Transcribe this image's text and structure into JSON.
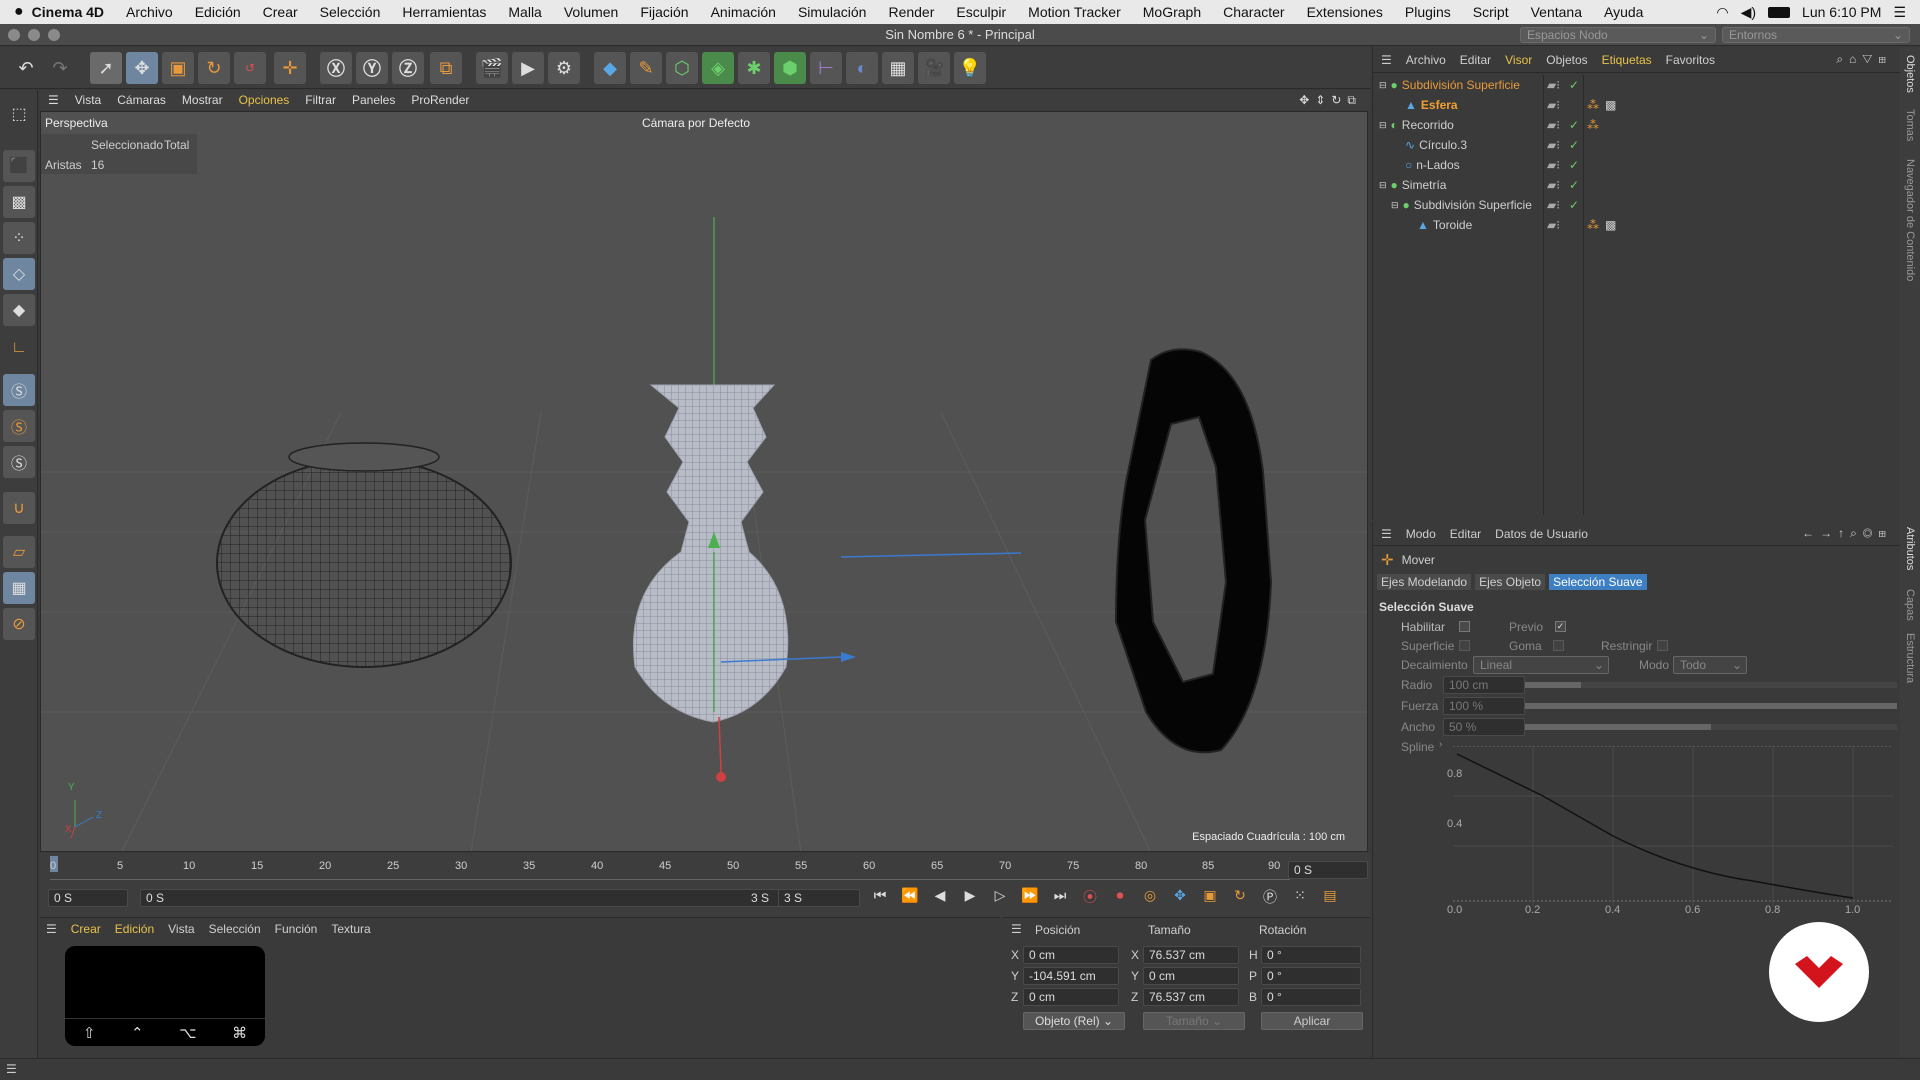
{
  "menubar": {
    "app": "Cinema 4D",
    "items": [
      "Archivo",
      "Edición",
      "Crear",
      "Selección",
      "Herramientas",
      "Malla",
      "Volumen",
      "Fijación",
      "Animación",
      "Simulación",
      "Render",
      "Esculpir",
      "Motion Tracker",
      "MoGraph",
      "Character",
      "Extensiones",
      "Plugins",
      "Script",
      "Ventana",
      "Ayuda"
    ],
    "clock": "Lun 6:10 PM"
  },
  "window": {
    "title": "Sin Nombre 6 * - Principal",
    "layout_combo": "Espacios Nodo",
    "env_combo": "Entornos"
  },
  "viewport": {
    "menu": [
      "Vista",
      "Cámaras",
      "Mostrar",
      "Opciones",
      "Filtrar",
      "Paneles",
      "ProRender"
    ],
    "active_menu": "Opciones",
    "label": "Perspectiva",
    "camera": "Cámara por Defecto",
    "stats": {
      "selected_header": "Seleccionado",
      "total_header": "Total",
      "row_label": "Aristas",
      "row_value": "16"
    },
    "grid": "Espaciado Cuadrícula : 100 cm",
    "axis": {
      "y": "Y",
      "x": "X",
      "z": "Z"
    }
  },
  "timeline": {
    "ticks": [
      "0",
      "5",
      "10",
      "15",
      "20",
      "25",
      "30",
      "35",
      "40",
      "45",
      "50",
      "55",
      "60",
      "65",
      "70",
      "75",
      "80",
      "85",
      "90"
    ],
    "frame_field": "0 S",
    "start": "0 S",
    "range_start": "0 S",
    "range_end": "3 S",
    "end": "3 S"
  },
  "materials": {
    "menu": [
      "Crear",
      "Edición",
      "Vista",
      "Selección",
      "Función",
      "Textura"
    ],
    "keys": [
      "⇧",
      "⌃",
      "⌥",
      "⌘"
    ]
  },
  "coords": {
    "headers": [
      "Posición",
      "Tamaño",
      "Rotación"
    ],
    "rows": [
      {
        "axis": "X",
        "pos": "0 cm",
        "saxis": "X",
        "size": "76.537 cm",
        "raxis": "H",
        "rot": "0 °"
      },
      {
        "axis": "Y",
        "pos": "-104.591 cm",
        "saxis": "Y",
        "size": "0 cm",
        "raxis": "P",
        "rot": "0 °"
      },
      {
        "axis": "Z",
        "pos": "0 cm",
        "saxis": "Z",
        "size": "76.537 cm",
        "raxis": "B",
        "rot": "0 °"
      }
    ],
    "mode": "Objeto (Rel)",
    "size_mode": "Tamaño",
    "apply": "Aplicar"
  },
  "objects": {
    "menu": [
      "Archivo",
      "Editar",
      "Visor",
      "Objetos",
      "Etiquetas",
      "Favoritos"
    ],
    "items": [
      {
        "name": "Subdivisión Superficie",
        "depth": 0,
        "color": "#e89a3a"
      },
      {
        "name": "Esfera",
        "depth": 1,
        "color": "#f0a030"
      },
      {
        "name": "Recorrido",
        "depth": 0,
        "color": "#cfcfcf"
      },
      {
        "name": "Círculo.3",
        "depth": 1,
        "color": "#cfcfcf"
      },
      {
        "name": "n-Lados",
        "depth": 1,
        "color": "#cfcfcf"
      },
      {
        "name": "Simetría",
        "depth": 0,
        "color": "#cfcfcf"
      },
      {
        "name": "Subdivisión Superficie",
        "depth": 1,
        "color": "#cfcfcf"
      },
      {
        "name": "Toroide",
        "depth": 2,
        "color": "#cfcfcf"
      }
    ]
  },
  "attributes": {
    "menu": [
      "Modo",
      "Editar",
      "Datos de Usuario"
    ],
    "tool": "Mover",
    "tabs": [
      "Ejes Modelando",
      "Ejes Objeto",
      "Selección Suave"
    ],
    "section": "Selección Suave",
    "habilitar": "Habilitar",
    "previo": "Previo",
    "superficie": "Superficie",
    "goma": "Goma",
    "restringir": "Restringir",
    "decaimiento_label": "Decaimiento",
    "decaimiento": "Lineal",
    "modo_label": "Modo",
    "modo": "Todo",
    "radio_label": "Radio",
    "radio": "100 cm",
    "fuerza_label": "Fuerza",
    "fuerza": "100 %",
    "ancho_label": "Ancho",
    "ancho": "50 %",
    "spline_label": "Spline",
    "graph_y": [
      "0.8",
      "0.4"
    ],
    "graph_x": [
      "0.0",
      "0.2",
      "0.4",
      "0.6",
      "0.8",
      "1.0"
    ],
    "radio_level": 0.15,
    "fuerza_level": 1.0,
    "ancho_level": 0.5
  },
  "sidetabs": [
    "Objetos",
    "Tomas",
    "Navegador de Contenido",
    "Atributos",
    "Capas",
    "Estructura"
  ],
  "colors": {
    "accent": "#4aa0ff",
    "active_tab": "#3d7fc1",
    "orange": "#e89a3a"
  }
}
